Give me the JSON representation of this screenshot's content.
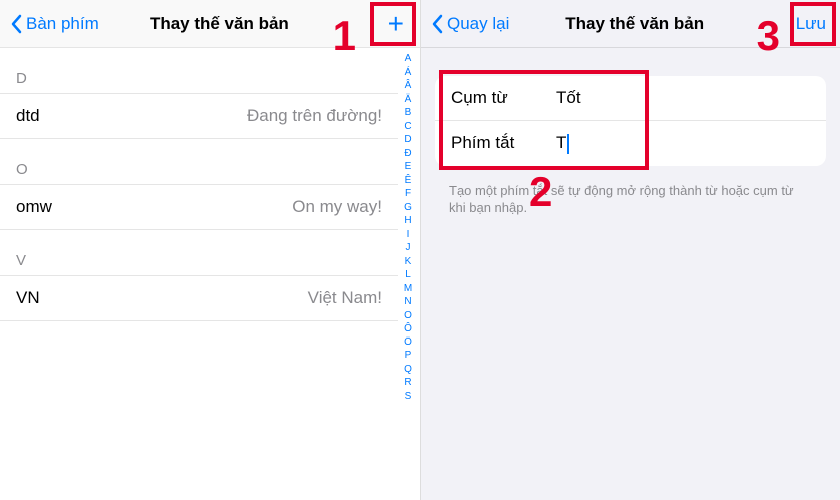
{
  "left": {
    "back_label": "Bàn phím",
    "title": "Thay thế văn bản",
    "add_glyph": "+",
    "sections": [
      {
        "letter": "D",
        "rows": [
          {
            "key": "dtd",
            "value": "Đang trên đường!"
          }
        ]
      },
      {
        "letter": "O",
        "rows": [
          {
            "key": "omw",
            "value": "On my way!"
          }
        ]
      },
      {
        "letter": "V",
        "rows": [
          {
            "key": "VN",
            "value": "Việt Nam!"
          }
        ]
      }
    ],
    "index_rail": [
      "A",
      "Á",
      "Â",
      "Ä",
      "B",
      "C",
      "D",
      "Đ",
      "E",
      "Ê",
      "F",
      "G",
      "H",
      "I",
      "J",
      "K",
      "L",
      "M",
      "N",
      "O",
      "Ô",
      "Ö",
      "P",
      "Q",
      "R",
      "S"
    ]
  },
  "right": {
    "back_label": "Quay lại",
    "title": "Thay thế văn bản",
    "save_label": "Lưu",
    "phrase_label": "Cụm từ",
    "phrase_value": "Tốt",
    "shortcut_label": "Phím tắt",
    "shortcut_value": "T",
    "hint": "Tạo một phím tắt sẽ tự động mở rộng thành từ hoặc cụm từ khi bạn nhập."
  },
  "annotation": {
    "n1": "1",
    "n2": "2",
    "n3": "3"
  }
}
